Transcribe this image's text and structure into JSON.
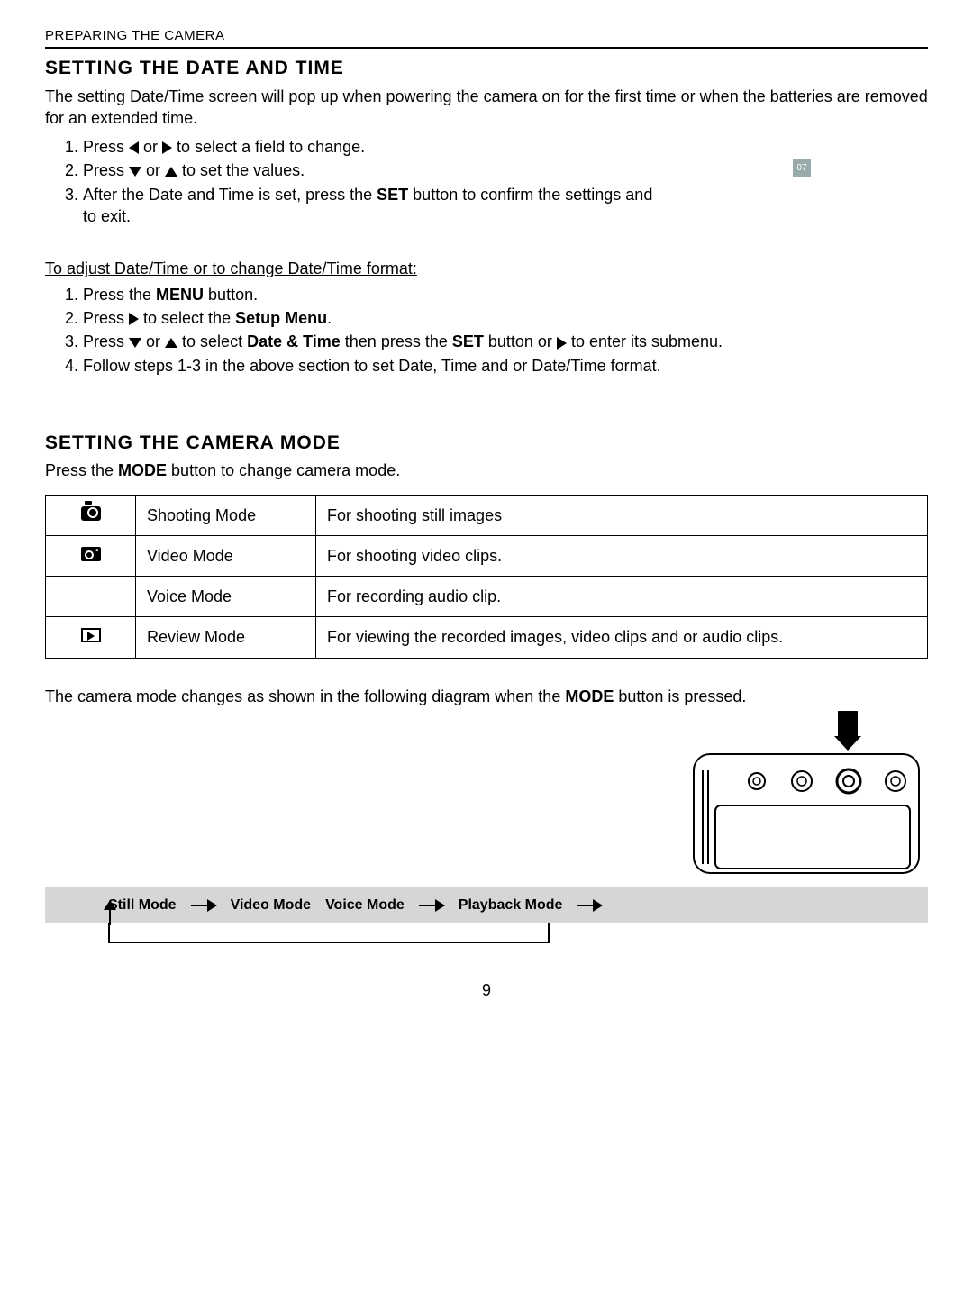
{
  "header": {
    "section_path": "PREPARING THE CAMERA"
  },
  "section1": {
    "title": "SETTING THE DATE AND TIME",
    "intro": "The setting Date/Time screen will pop up when powering the camera on for the first time or when the batteries are removed for an extended time.",
    "steps": {
      "s1_a": "Press ",
      "s1_b": " or ",
      "s1_c": " to select a field to change.",
      "s2_a": "Press ",
      "s2_b": " or ",
      "s2_c": " to set the values.",
      "s3_a": "After the Date and Time is set, press the ",
      "s3_set": "SET",
      "s3_b": " button to confirm the settings and to exit."
    },
    "adjust_heading": "To adjust Date/Time or to change Date/Time format:",
    "adjust": {
      "a1_a": "Press the ",
      "a1_menu": "MENU",
      "a1_b": " button.",
      "a2_a": "Press ",
      "a2_b": " to select the ",
      "a2_bold": "Setup Menu",
      "a2_c": ".",
      "a3_a": "Press ",
      "a3_b": " or ",
      "a3_c": " to select ",
      "a3_bold": "Date & Time",
      "a3_d": " then press the ",
      "a3_set": "SET",
      "a3_e": " button or ",
      "a3_f": " to enter its submenu.",
      "a4": "Follow steps 1-3 in the above section to set Date, Time and or Date/Time format."
    },
    "fig_placeholder": "07"
  },
  "section2": {
    "title": "SETTING THE CAMERA MODE",
    "intro_a": "Press the ",
    "intro_mode": "MODE",
    "intro_b": " button to change camera mode.",
    "table": [
      {
        "icon": "camera",
        "name": "Shooting Mode",
        "desc": "For shooting still images"
      },
      {
        "icon": "video",
        "name": "Video Mode",
        "desc": "For shooting video clips."
      },
      {
        "icon": "",
        "name": "Voice Mode",
        "desc": "For recording audio clip."
      },
      {
        "icon": "review",
        "name": "Review Mode",
        "desc": "For viewing the recorded images, video clips and or audio clips."
      }
    ],
    "after_table_a": "The camera mode changes as shown in the following diagram when the ",
    "after_table_mode": "MODE",
    "after_table_b": " button is pressed.",
    "flow": {
      "n1": "Still Mode",
      "n2": "Video Mode",
      "n3": "Voice Mode",
      "n4": "Playback Mode"
    }
  },
  "page_number": "9"
}
